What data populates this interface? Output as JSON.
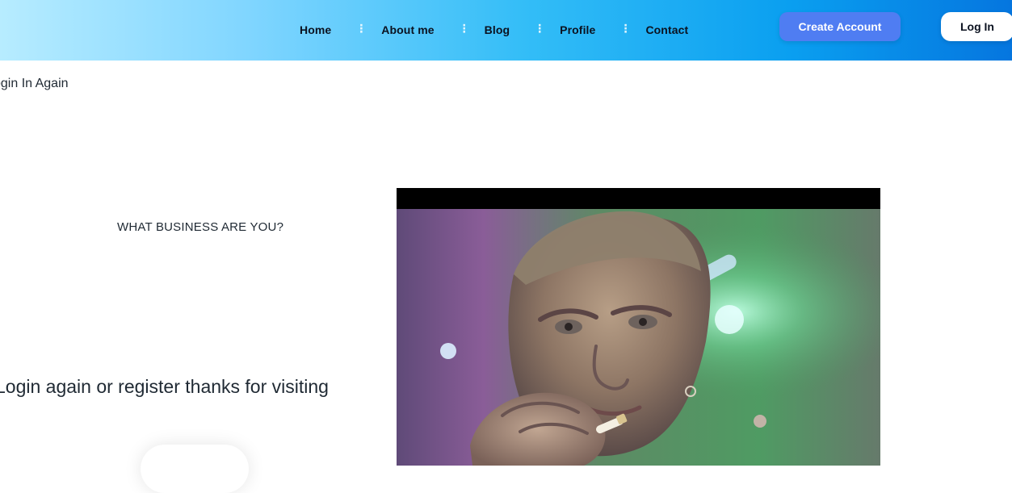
{
  "header": {
    "nav": [
      {
        "label": "Home"
      },
      {
        "label": "About me"
      },
      {
        "label": "Blog"
      },
      {
        "label": "Profile"
      },
      {
        "label": "Contact"
      }
    ],
    "create_account_label": "Create Account",
    "login_label": "Log In"
  },
  "breadcrumb": {
    "text": "ogin In Again"
  },
  "main": {
    "question": "WHAT BUSINESS ARE YOU?",
    "message": "Login again or register thanks for visiting"
  },
  "colors": {
    "accent": "#4f7df2",
    "header_gradient_start": "#b7ecff",
    "header_gradient_end": "#0576df"
  }
}
